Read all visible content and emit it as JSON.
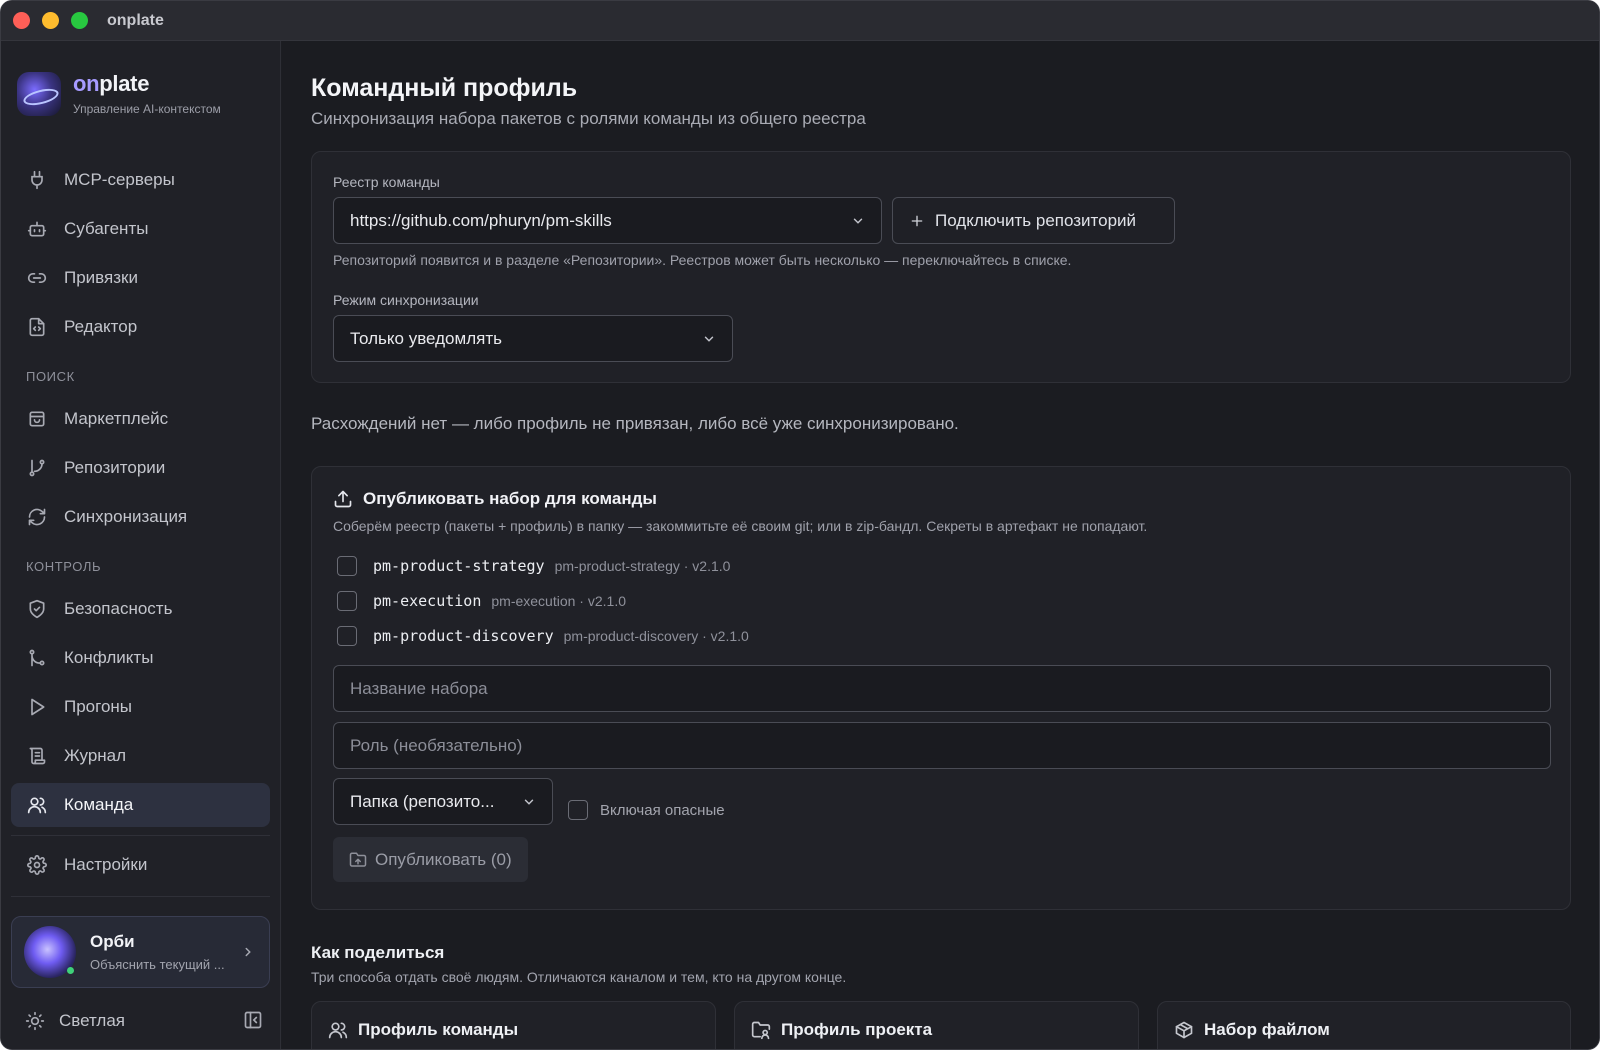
{
  "window": {
    "title": "onplate"
  },
  "brand": {
    "name_prefix": "on",
    "name_suffix": "plate",
    "subtitle": "Управление AI-контекстом"
  },
  "sidebar": {
    "items_top": [
      {
        "label": "MCP-серверы",
        "icon": "plug-icon"
      },
      {
        "label": "Субагенты",
        "icon": "robot-icon"
      },
      {
        "label": "Привязки",
        "icon": "link-icon"
      },
      {
        "label": "Редактор",
        "icon": "code-file-icon"
      }
    ],
    "section_search": "ПОИСК",
    "items_search": [
      {
        "label": "Маркетплейс",
        "icon": "store-icon"
      },
      {
        "label": "Репозитории",
        "icon": "git-branch-icon"
      },
      {
        "label": "Синхронизация",
        "icon": "refresh-icon"
      }
    ],
    "section_control": "КОНТРОЛЬ",
    "items_control": [
      {
        "label": "Безопасность",
        "icon": "shield-icon"
      },
      {
        "label": "Конфликты",
        "icon": "git-merge-icon"
      },
      {
        "label": "Прогоны",
        "icon": "play-icon"
      },
      {
        "label": "Журнал",
        "icon": "scroll-icon"
      },
      {
        "label": "Команда",
        "icon": "users-icon",
        "active": true
      }
    ],
    "settings": {
      "label": "Настройки",
      "icon": "gear-icon"
    },
    "orbi": {
      "name": "Орби",
      "desc": "Объяснить текущий ..."
    },
    "theme": {
      "label": "Светлая"
    }
  },
  "page": {
    "title": "Командный профиль",
    "subtitle": "Синхронизация набора пакетов с ролями команды из общего реестра"
  },
  "registry": {
    "label": "Реестр команды",
    "value": "https://github.com/phuryn/pm-skills",
    "connect_button": "Подключить репозиторий",
    "hint": "Репозиторий появится и в разделе «Репозитории». Реестров может быть несколько — переключайтесь в списке.",
    "sync_label": "Режим синхронизации",
    "sync_value": "Только уведомлять"
  },
  "info_line": "Расхождений нет — либо профиль не привязан, либо всё уже синхронизировано.",
  "publish": {
    "title": "Опубликовать набор для команды",
    "desc": "Соберём реестр (пакеты + профиль) в папку — закоммитьте её своим git; или в zip-бандл. Секреты в артефакт не попадают.",
    "packages": [
      {
        "name": "pm-product-strategy",
        "meta": "pm-product-strategy · v2.1.0"
      },
      {
        "name": "pm-execution",
        "meta": "pm-execution · v2.1.0"
      },
      {
        "name": "pm-product-discovery",
        "meta": "pm-product-discovery · v2.1.0"
      }
    ],
    "name_placeholder": "Название набора",
    "role_placeholder": "Роль (необязательно)",
    "target_value": "Папка (репозито...",
    "dangerous_label": "Включая опасные",
    "publish_button": "Опубликовать (0)"
  },
  "share": {
    "title": "Как поделиться",
    "subtitle": "Три способа отдать своё людям. Отличаются каналом и тем, кто на другом конце.",
    "cards": [
      {
        "label": "Профиль команды",
        "icon": "users-icon"
      },
      {
        "label": "Профиль проекта",
        "icon": "folder-user-icon"
      },
      {
        "label": "Набор файлом",
        "icon": "package-icon"
      }
    ]
  }
}
